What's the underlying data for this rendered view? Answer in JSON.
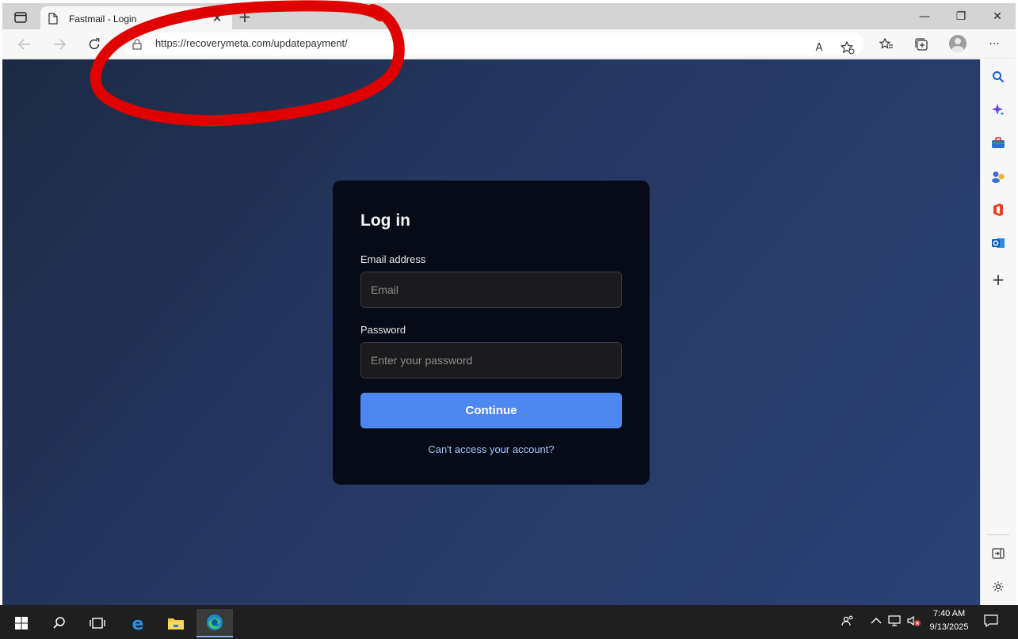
{
  "browser": {
    "tab_title": "Fastmail - Login",
    "tab_close": "✕",
    "new_tab": "+",
    "address": "https://recoverymeta.com/updatepayment/",
    "read_aloud_label": "A",
    "more_label": "···",
    "window": {
      "minimize": "—",
      "restore": "❐",
      "close": "✕"
    }
  },
  "login": {
    "title": "Log in",
    "email_label": "Email address",
    "email_placeholder": "Email",
    "password_label": "Password",
    "password_placeholder": "Enter your password",
    "continue_label": "Continue",
    "help_link": "Can't access your account?"
  },
  "sidebar": {
    "add_label": "+",
    "icons": [
      "search-icon",
      "copilot-icon",
      "tools-icon",
      "games-icon",
      "office-icon",
      "outlook-icon",
      "add-icon",
      "hide-sidebar-icon",
      "settings-icon"
    ]
  },
  "taskbar": {
    "time": "7:40 AM",
    "date": "9/13/2025",
    "icons": [
      "windows-start-icon",
      "search-icon",
      "task-view-icon",
      "internet-explorer-icon",
      "file-explorer-icon",
      "edge-icon"
    ]
  },
  "colors": {
    "annotation": "#e00000",
    "primary_button": "#4f87f0",
    "card": "#060b17",
    "link": "#a9c7ff"
  }
}
